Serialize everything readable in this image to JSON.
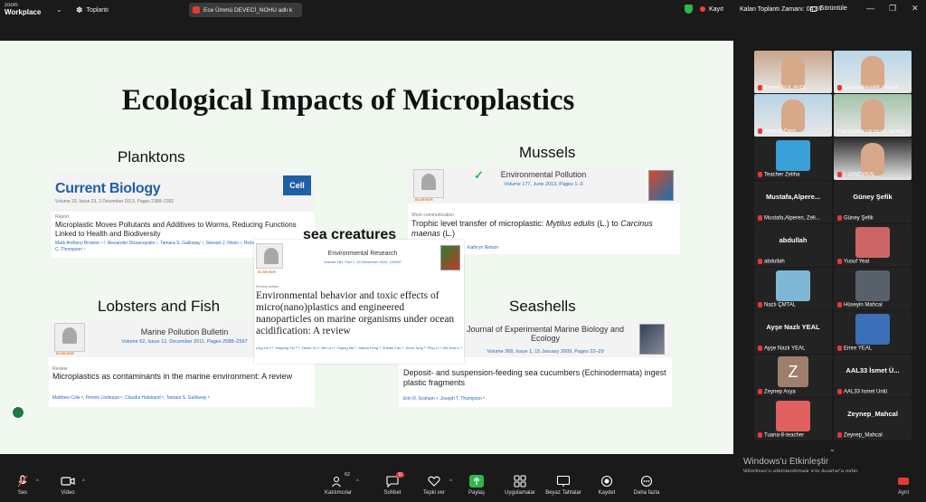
{
  "app": {
    "logo_line1": "zoom",
    "logo_line2": "Workplace",
    "meeting_label": "Toplantı"
  },
  "share_pill": {
    "text": "Ece Ümmü DEVECİ_NOHU adlı k"
  },
  "status": {
    "recording_label": "Kayıt",
    "remaining": "Kalan Toplantı Zamanı: 04:57",
    "view_label": "Görüntüle"
  },
  "slide": {
    "title": "Ecological Impacts of Microplastics",
    "sections": {
      "planktons": "Planktons",
      "mussels": "Mussels",
      "lobsters": "Lobsters and Fish",
      "seashells": "Seashells",
      "sea_creatures": "sea creatures"
    },
    "planktons_card": {
      "journal": "Current Biology",
      "badge": "Cell",
      "volume": "Volume 23, Issue 23, 2 December 2013, Pages 2388–2392",
      "type": "Report",
      "title": "Microplastic Moves Pollutants and Additives to Worms, Reducing Functions Linked to Health and Biodiversity",
      "authors": "Mark Anthony Browne ¹·², Alexander Dissanayake ¹, Tamara S. Galloway ¹, Stewart J. Niven ¹, Richard C. Thompson ¹"
    },
    "mussels_card": {
      "journal": "Environmental Pollution",
      "volume": "Volume 177, June 2013, Pages 1–3",
      "type": "Short communication",
      "title_plain1": "Trophic level transfer of microplastic: ",
      "title_italic1": "Mytilus edulis",
      "title_plain2": " (L.) to ",
      "title_italic2": "Carcinus maenas",
      "title_plain3": " (L.)",
      "authors": "Kathryn Nelson"
    },
    "sea_card": {
      "journal": "Environmental Research",
      "volume": "Volume 261, Part 1, 15 December 2024, 120267",
      "type": "Review article",
      "title": "Environmental behavior and toxic effects of micro(nano)plastics and engineered nanoparticles on marine organisms under ocean acidification: A review",
      "authors": "Ling Liu ᵃ·¹, Haiyang Yin ᵇ·¹, Yanan Xu ᵃ, Bin Liu ᵃ, Yuqing Ma ᵃ, Jiahua Feng ᵃ, Zhihan Cao ᵃ, Jinho Jung ᵇ, Ping Li ᵃ, Zhi-Hua Li ᵃ"
    },
    "lobsters_card": {
      "journal": "Marine Pollution Bulletin",
      "volume": "Volume 62, Issue 12, December 2011, Pages 2588–2597",
      "type": "Review",
      "title": "Microplastics as contaminants in the marine environment: A review",
      "authors": "Matthew Cole ᵃ, Pennie Lindeque ᵇ, Claudia Halsband ᵇ, Tamara S. Galloway ᵃ"
    },
    "seashells_card": {
      "journal": "Journal of Experimental Marine Biology and Ecology",
      "volume": "Volume 368, Issue 1, 15 January 2009, Pages 22–29",
      "title": "Deposit- and suspension-feeding sea cucumbers (Echinodermata) ingest plastic fragments",
      "authors": "Erin R. Graham ᵃ, Joseph T. Thompson ᵇ"
    },
    "elsevier": "ELSEVIER"
  },
  "participants": [
    {
      "name": "Emine GÜL AVCI",
      "kind": "video",
      "muted": true
    },
    {
      "name": "Gonca BAHAR / Yusuf...",
      "kind": "video",
      "muted": true
    },
    {
      "name": "Ariyeza Çerri",
      "kind": "video",
      "muted": true
    },
    {
      "name": "Ece Ümmü DEVECİ_NOHU",
      "kind": "video",
      "muted": false
    },
    {
      "name": "Teacher Zeliha",
      "kind": "avatar",
      "muted": true
    },
    {
      "name": "İ. GİNÇYKAL",
      "kind": "video",
      "muted": true
    },
    {
      "name": "Mustafa,Alperen, Zeli...",
      "big": "Mustafa,Alpere...",
      "kind": "text",
      "muted": true
    },
    {
      "name": "Güney Şefik",
      "big": "Güney Şefik",
      "kind": "text",
      "muted": true
    },
    {
      "name": "abdullah",
      "big": "abdullah",
      "kind": "text",
      "muted": true
    },
    {
      "name": "Yusuf Yeal",
      "kind": "avatar",
      "muted": true
    },
    {
      "name": "Nazlı ÇMTAL",
      "kind": "avatar",
      "muted": true
    },
    {
      "name": "Hüseyin Mahcal",
      "kind": "avatar",
      "muted": true
    },
    {
      "name": "Ayşe Nazlı YEAL",
      "big": "Ayşe Nazlı YEAL",
      "kind": "text",
      "muted": true
    },
    {
      "name": "Emre YEAL",
      "kind": "avatar",
      "muted": true
    },
    {
      "name": "Zeynep Asya",
      "letter": "Z",
      "kind": "letter",
      "muted": true
    },
    {
      "name": "AAL33 İsmet Ünlü",
      "big": "AAL33 İsmet Ü...",
      "kind": "text",
      "muted": true
    },
    {
      "name": "Tuana-8-teacher",
      "kind": "avatar",
      "muted": true
    },
    {
      "name": "Zeynep_Mahcal",
      "big": "Zeynep_Mahcal",
      "kind": "text",
      "muted": true
    }
  ],
  "windows_activation": {
    "line1": "Windows'u Etkinleştir",
    "line2": "Windows'u etkinleştirmek için Ayarlar'a gidin."
  },
  "toolbar": {
    "audio": "Ses",
    "video": "Video",
    "participants": "Katılımcılar",
    "participants_count": "62",
    "chat": "Sohbet",
    "chat_badge": "11",
    "reactions": "Tepki ver",
    "share": "Paylaş",
    "apps": "Uygulamalar",
    "whiteboards": "Beyaz Tahtalar",
    "record": "Kaydet",
    "more": "Daha fazla",
    "leave": "Ayrıl"
  }
}
